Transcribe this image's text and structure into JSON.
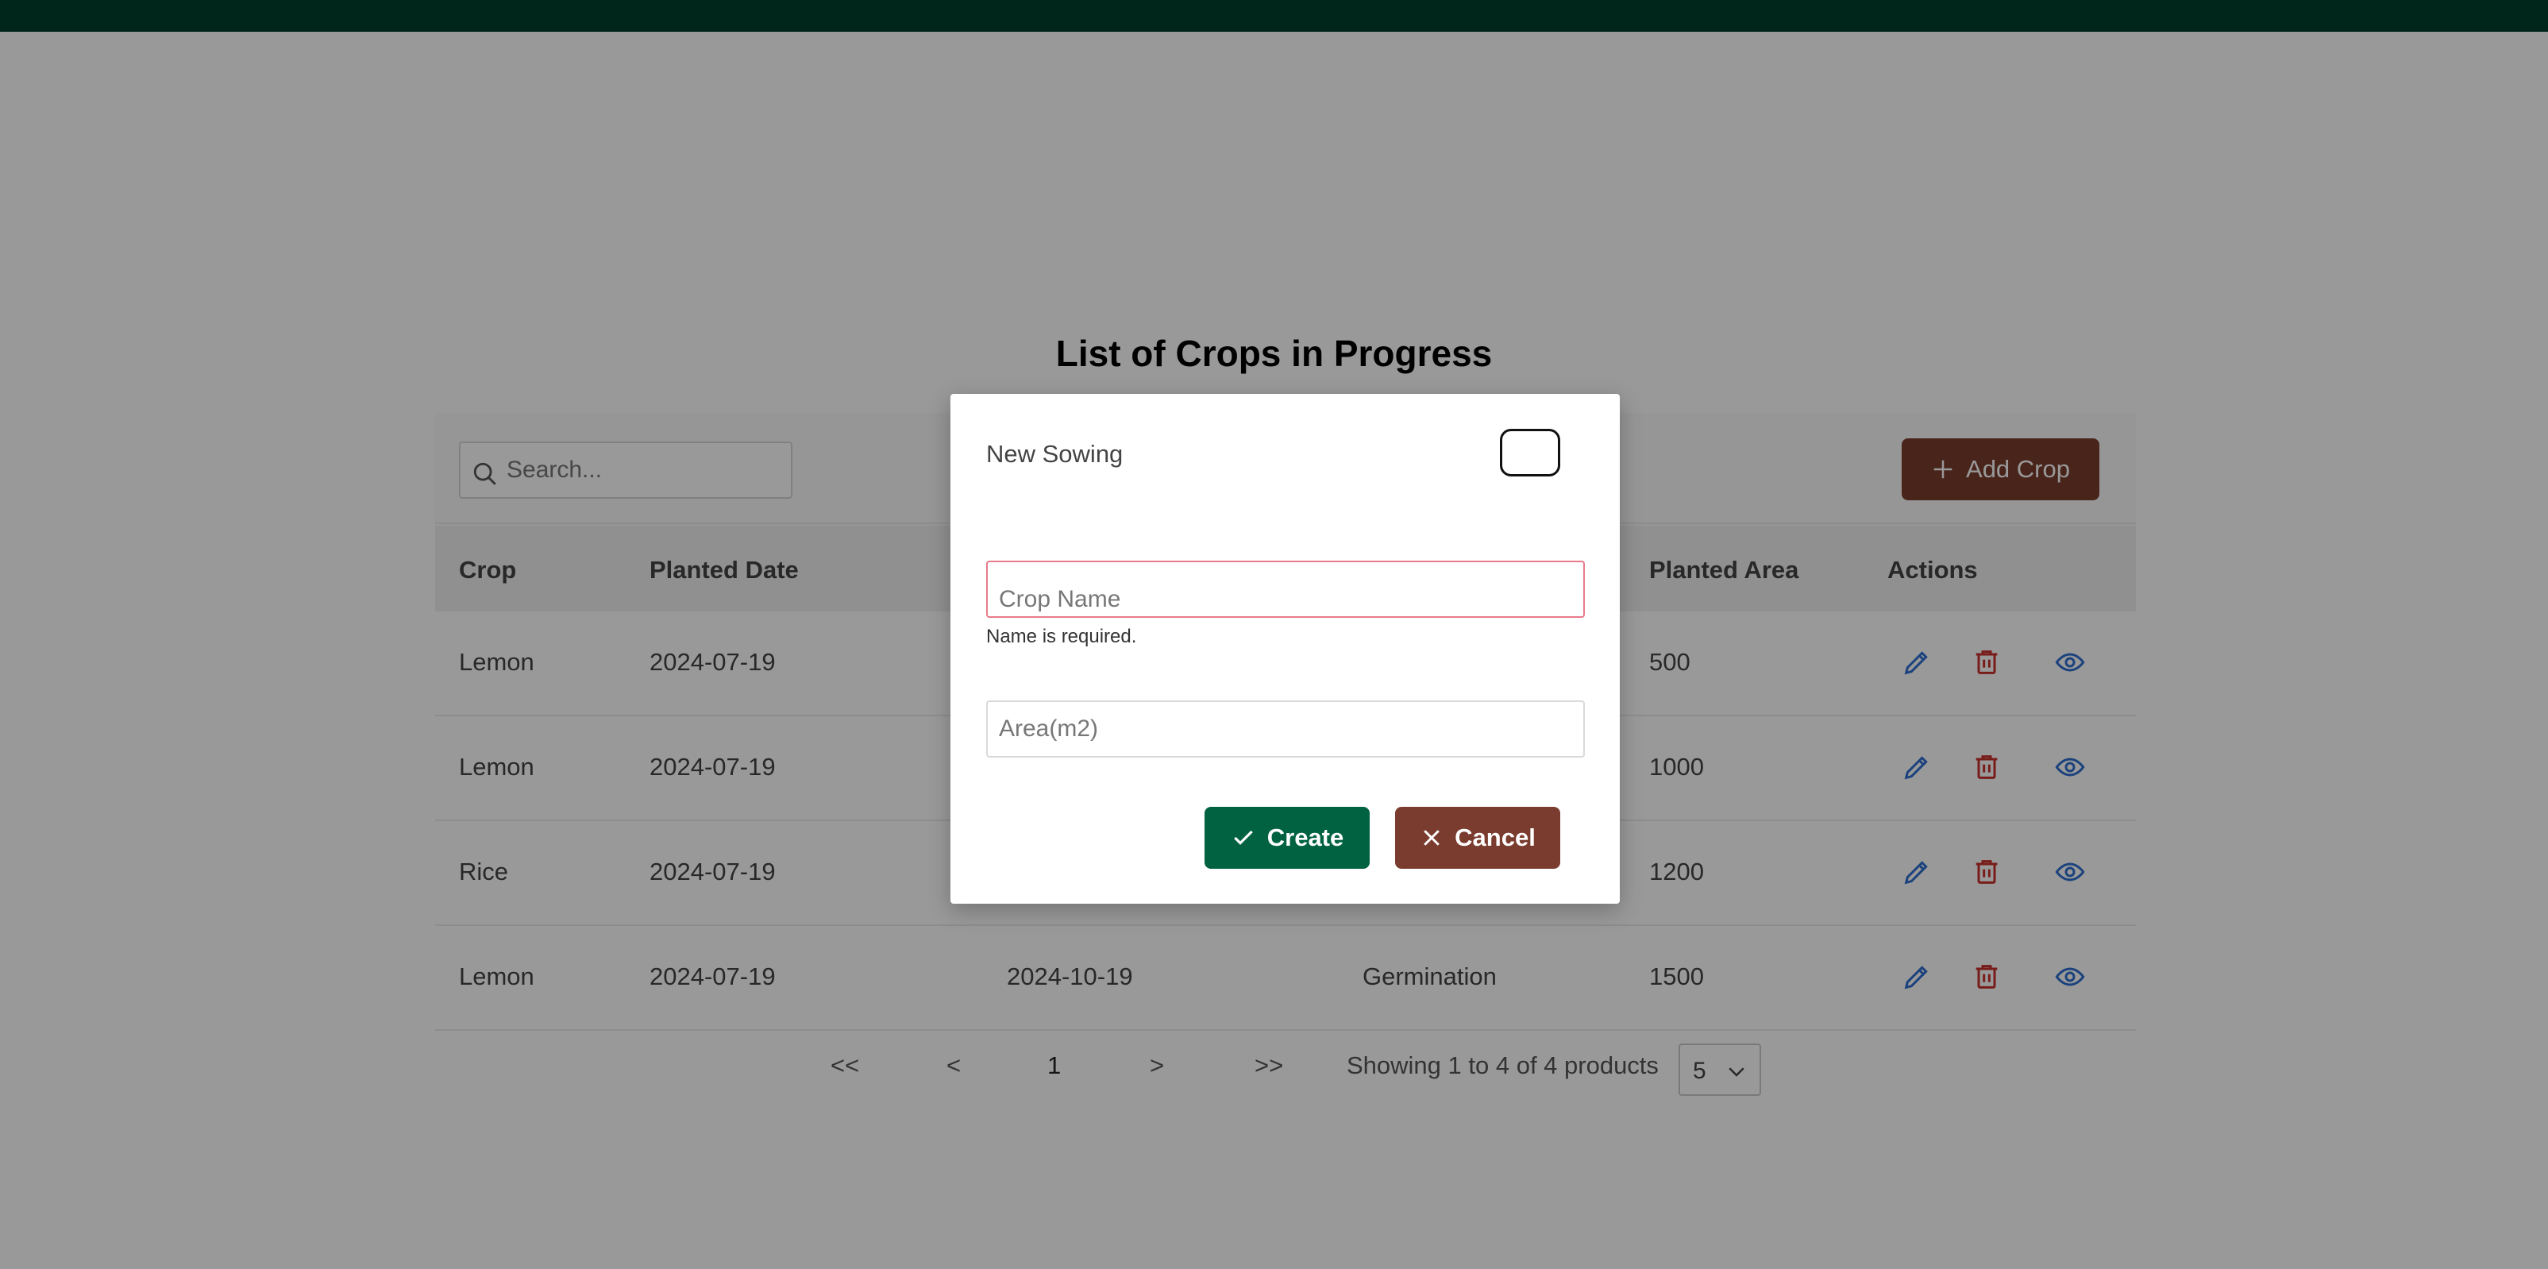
{
  "page": {
    "title": "List of Crops in Progress"
  },
  "toolbar": {
    "search_placeholder": "Search...",
    "add_label": "Add Crop"
  },
  "table": {
    "columns": [
      "Crop",
      "Planted Date",
      "",
      "",
      "Planted Area",
      "Actions"
    ],
    "rows": [
      {
        "crop": "Lemon",
        "planted_date": "2024-07-19",
        "harvest_date": "",
        "stage": "",
        "area": "500"
      },
      {
        "crop": "Lemon",
        "planted_date": "2024-07-19",
        "harvest_date": "",
        "stage": "",
        "area": "1000"
      },
      {
        "crop": "Rice",
        "planted_date": "2024-07-19",
        "harvest_date": "",
        "stage": "",
        "area": "1200"
      },
      {
        "crop": "Lemon",
        "planted_date": "2024-07-19",
        "harvest_date": "2024-10-19",
        "stage": "Germination",
        "area": "1500"
      }
    ]
  },
  "pagination": {
    "first": "<<",
    "prev": "<",
    "current": "1",
    "next": ">",
    "last": ">>",
    "summary": "Showing 1 to 4 of 4 products",
    "per_page": "5"
  },
  "modal": {
    "title": "New Sowing",
    "crop_placeholder": "Crop Name",
    "crop_error": "Name is required.",
    "area_placeholder": "Area(m2)",
    "create_label": "Create",
    "cancel_label": "Cancel"
  },
  "colors": {
    "topbar": "#00402d",
    "primary": "#006241",
    "brown": "#7a3c2e",
    "edit_icon": "#2f6fd1",
    "delete_icon": "#c9302c",
    "view_icon": "#2f6fd1",
    "error_border": "#e87a8a"
  },
  "icons": {
    "search": "search-icon",
    "add": "plus-icon",
    "edit": "pencil-icon",
    "delete": "trash-icon",
    "view": "eye-icon",
    "create": "check-icon",
    "cancel": "x-icon",
    "per_page": "chevron-down-icon"
  }
}
